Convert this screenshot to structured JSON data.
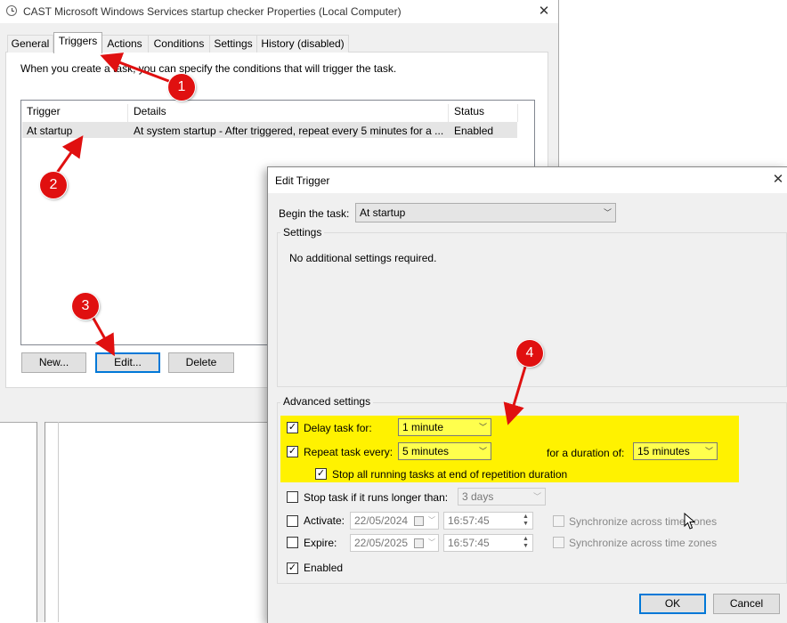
{
  "properties_window": {
    "title": "CAST Microsoft Windows Services startup checker Properties (Local Computer)",
    "close_glyph": "✕",
    "tabs": [
      "General",
      "Triggers",
      "Actions",
      "Conditions",
      "Settings",
      "History (disabled)"
    ],
    "active_tab": "Triggers",
    "intro_text": "When you create a task, you can specify the conditions that will trigger the task.",
    "columns": [
      "Trigger",
      "Details",
      "Status"
    ],
    "rows": [
      {
        "trigger": "At startup",
        "details": "At system startup - After triggered, repeat every 5 minutes for a ...",
        "status": "Enabled"
      }
    ],
    "buttons": {
      "new": "New...",
      "edit": "Edit...",
      "delete": "Delete"
    }
  },
  "edit_trigger": {
    "title": "Edit Trigger",
    "close_glyph": "✕",
    "begin_label": "Begin the task:",
    "begin_value": "At startup",
    "settings_group": "Settings",
    "settings_text": "No additional settings required.",
    "advanced_group": "Advanced settings",
    "delay": {
      "label": "Delay task for:",
      "value": "1 minute",
      "checked": true
    },
    "repeat": {
      "label": "Repeat task every:",
      "value": "5 minutes",
      "checked": true,
      "duration_label": "for a duration of:",
      "duration_value": "15 minutes"
    },
    "stop_running": {
      "label": "Stop all running tasks at end of repetition duration",
      "checked": true
    },
    "stop_longer": {
      "label": "Stop task if it runs longer than:",
      "value": "3 days",
      "checked": false
    },
    "activate": {
      "label": "Activate:",
      "date": "22/05/2024",
      "time": "16:57:45",
      "checked": false,
      "sync_label": "Synchronize across time zones"
    },
    "expire": {
      "label": "Expire:",
      "date": "22/05/2025",
      "time": "16:57:45",
      "checked": false,
      "sync_label": "Synchronize across time zones"
    },
    "enabled": {
      "label": "Enabled",
      "checked": true
    },
    "ok_label": "OK",
    "cancel_label": "Cancel"
  },
  "annotations": [
    "1",
    "2",
    "3",
    "4"
  ],
  "colors": {
    "highlight": "#fff200",
    "badge": "#e01010",
    "focus_border": "#0078d7"
  },
  "check_glyph": "✓",
  "dropdown_glyph": "﹀"
}
